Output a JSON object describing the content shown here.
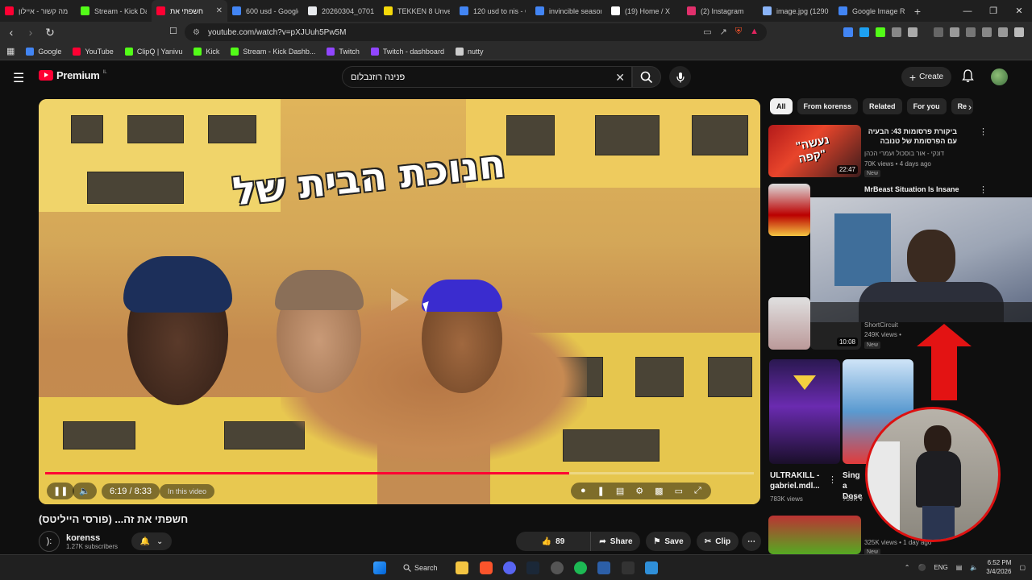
{
  "browser": {
    "tabs": [
      {
        "label": "מה קשור - איילון",
        "color": "#ff0033"
      },
      {
        "label": "Stream - Kick Da",
        "color": "#53fc18"
      },
      {
        "label": "חשפתי את",
        "color": "#ff0033",
        "active": true
      },
      {
        "label": "600 usd - Google",
        "color": "#4285f4"
      },
      {
        "label": "20260304_07013",
        "color": "#e8eaed"
      },
      {
        "label": "TEKKEN 8 Unveil",
        "color": "#f5d90a"
      },
      {
        "label": "120 usd to nis - G",
        "color": "#4285f4"
      },
      {
        "label": "invincible season",
        "color": "#4285f4"
      },
      {
        "label": "(19) Home / X",
        "color": "#ffffff"
      },
      {
        "label": "(2) Instagram",
        "color": "#e1306c"
      },
      {
        "label": "image.jpg (1290",
        "color": "#8ab4f8"
      },
      {
        "label": "Google Image Re",
        "color": "#4285f4"
      }
    ],
    "url": "youtube.com/watch?v=pXJUuh5Pw5M",
    "bookmarks": [
      {
        "label": "Google",
        "color": "#4285f4"
      },
      {
        "label": "YouTube",
        "color": "#ff0033"
      },
      {
        "label": "ClipQ | Yanivu",
        "color": "#53fc18"
      },
      {
        "label": "Kick",
        "color": "#53fc18"
      },
      {
        "label": "Stream - Kick Dashb...",
        "color": "#53fc18"
      },
      {
        "label": "Twitch",
        "color": "#9146ff"
      },
      {
        "label": "Twitch - dashboard",
        "color": "#9146ff"
      },
      {
        "label": "nutty",
        "color": "#cccccc"
      }
    ]
  },
  "youtube": {
    "logo": "Premium",
    "logo_country": "IL",
    "search_value": "פנינה רוזנבלום",
    "create_label": "Create"
  },
  "player": {
    "overlay_title": "חנוכת הבית של",
    "time": "6:19 / 8:33",
    "chapter": "In this video",
    "progress": 0.74
  },
  "video": {
    "title": "חשפתי את זה... (פורסי הייליטס)",
    "channel": "korenss",
    "channel_avatar": "):",
    "subscribers": "1.27K subscribers",
    "likes": "89",
    "share": "Share",
    "save": "Save",
    "clip": "Clip"
  },
  "chips": [
    "All",
    "From korenss",
    "Related",
    "For you",
    "Re"
  ],
  "recommendations": [
    {
      "title": "ביקורת פרסומות 43: הבעיה עם הפרסומת של טנובה",
      "channel": "דונקי - אור בוסכול ועמרי הכהן",
      "meta": "70K views • 4 days ago",
      "badge": "New",
      "duration": "22:47"
    },
    {
      "title": "MrBeast Situation Is Insane",
      "channel": "",
      "meta": "",
      "badge": "",
      "duration": ""
    },
    {
      "title": "",
      "channel": "ShortCircuit",
      "meta": "249K views •",
      "badge": "New",
      "duration": "10:08"
    }
  ],
  "shorts": [
    {
      "title": "ULTRAKILL - gabriel.mdl...",
      "views": "783K views"
    },
    {
      "title": "Sing a Dose",
      "views": "759K v"
    }
  ],
  "last_rec": {
    "meta": "325K views • 1 day ago",
    "badge": "New"
  },
  "taskbar": {
    "search": "Search",
    "lang": "ENG",
    "time": "6:52 PM",
    "date": "3/4/2026"
  }
}
